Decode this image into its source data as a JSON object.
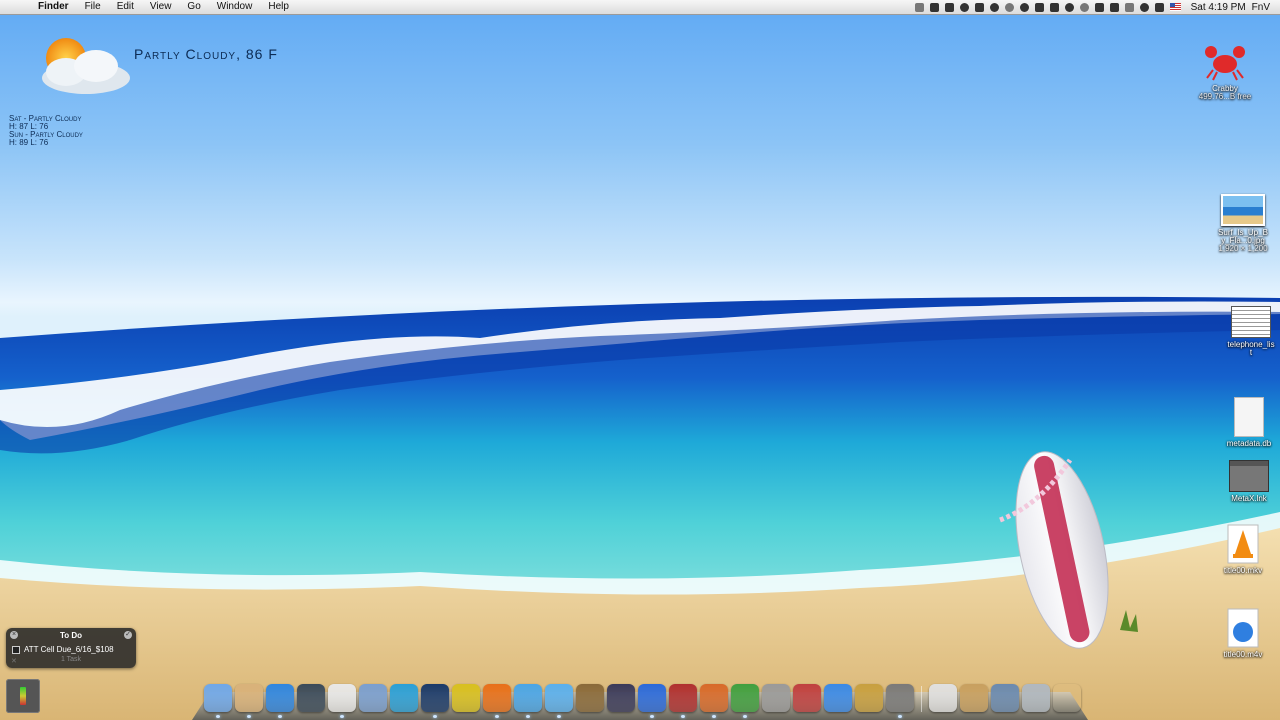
{
  "menubar": {
    "app_name": "Finder",
    "menus": [
      "File",
      "Edit",
      "View",
      "Go",
      "Window",
      "Help"
    ],
    "clock": "Sat 4:19 PM",
    "user": "FnV"
  },
  "weather": {
    "current": "Partly Cloudy, 86 F",
    "forecast": [
      {
        "day": "Sat - Partly Cloudy",
        "temps": "H: 87  L: 76"
      },
      {
        "day": "Sun - Partly Cloudy",
        "temps": "H: 89  L: 76"
      }
    ]
  },
  "desktop_icons": [
    {
      "name": "Crabby",
      "sub": "499.76...B free"
    },
    {
      "name": "Surf_Is_Up_B",
      "name2": "y_Fla...0.jpg",
      "sub": "1,920 × 1,200"
    },
    {
      "name": "telephone_lis",
      "name2": "t",
      "sub": ""
    },
    {
      "name": "metadata.db",
      "sub": ""
    },
    {
      "name": "MetaX.lnk",
      "sub": ""
    },
    {
      "name": "title00.mkv",
      "sub": ""
    },
    {
      "name": "title00.m4v",
      "sub": ""
    }
  ],
  "todo": {
    "title": "To Do",
    "task": "ATT Cell Due_6/16_$108",
    "count": "1 Task"
  },
  "colors": {
    "accent": "#3b7fd6",
    "sand": "#e9c98f",
    "ocean": "#1f7fd0"
  },
  "dock_icons": [
    "finder-icon",
    "mail-stamp-icon",
    "app-store-icon",
    "facetime-icon",
    "calendar-icon",
    "preview-icon",
    "network-globe-icon",
    "photoshop-icon",
    "fireworks-icon",
    "firefox-icon",
    "safari-icon",
    "itunes-icon",
    "iphoto-icon",
    "pen-tool-icon",
    "word-icon",
    "vmware-icon",
    "palm-tree-app-icon",
    "mkv-icon",
    "disk-utility-icon",
    "system-tool-icon",
    "wifi-icon",
    "keychain-lock-icon",
    "calculator-icon",
    "document-icon",
    "folder-icon",
    "screen-window-icon",
    "desktop-stack-icon",
    "trash-icon"
  ]
}
